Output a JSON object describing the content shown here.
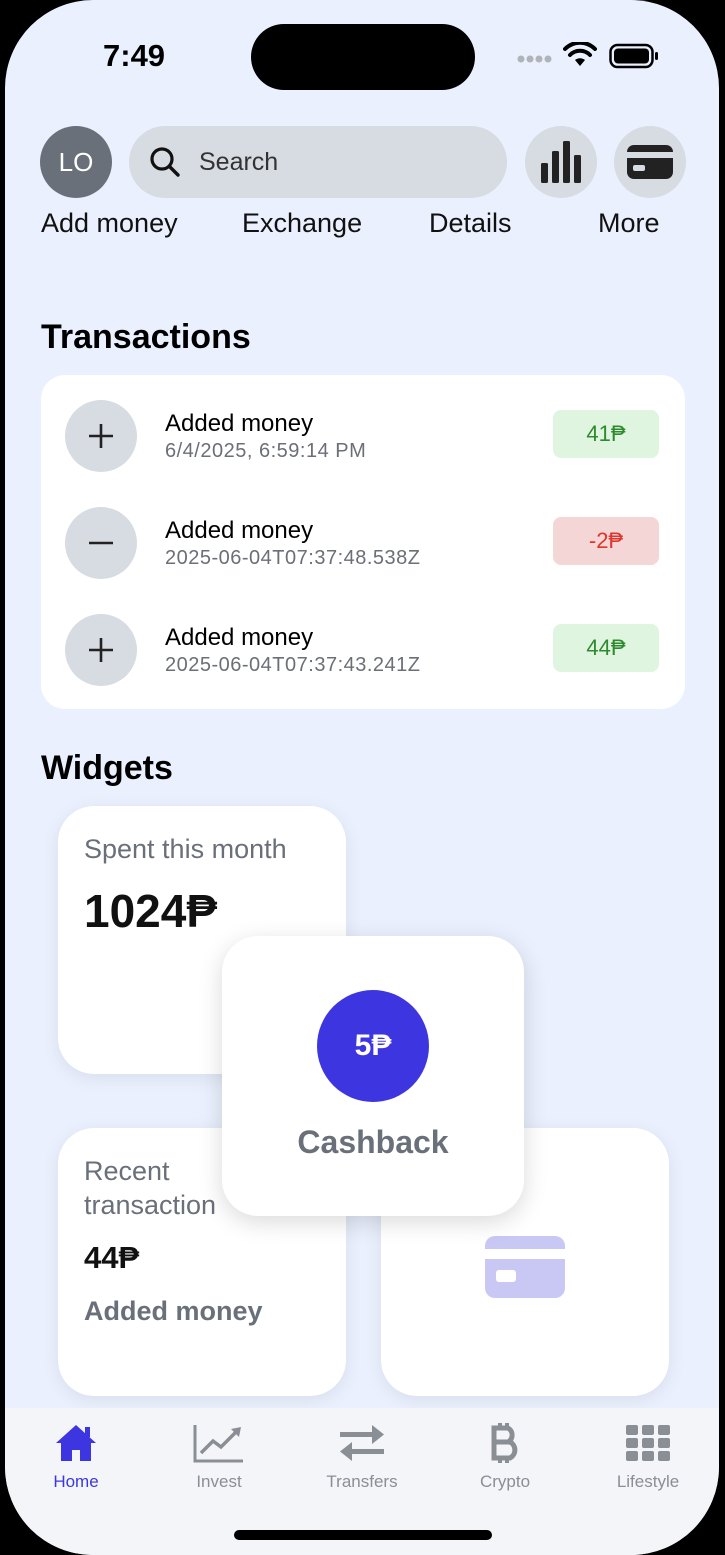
{
  "status": {
    "time": "7:49"
  },
  "header": {
    "avatar_initials": "LO",
    "search_placeholder": "Search",
    "stats_icon": "bar-chart-icon",
    "card_icon": "card-icon"
  },
  "actions": [
    {
      "label": "Add money"
    },
    {
      "label": "Exchange"
    },
    {
      "label": "Details"
    },
    {
      "label": "More"
    }
  ],
  "transactions": {
    "title": "Transactions",
    "items": [
      {
        "icon": "plus-icon",
        "title": "Added money",
        "date": "6/4/2025, 6:59:14 PM",
        "amount": "41₱",
        "type": "positive"
      },
      {
        "icon": "minus-icon",
        "title": "Added money",
        "date": "2025-06-04T07:37:48.538Z",
        "amount": "-2₱",
        "type": "negative"
      },
      {
        "icon": "plus-icon",
        "title": "Added money",
        "date": "2025-06-04T07:37:43.241Z",
        "amount": "44₱",
        "type": "positive"
      }
    ]
  },
  "widgets": {
    "title": "Widgets",
    "spent": {
      "label": "Spent this month",
      "value": "1024₱"
    },
    "cashback": {
      "value": "5₱",
      "label": "Cashback"
    },
    "recent": {
      "label_line1": "Recent",
      "label_line2": "transaction",
      "value": "44₱",
      "description": "Added money"
    },
    "card": {
      "icon": "card-icon"
    }
  },
  "tabbar": {
    "items": [
      {
        "label": "Home",
        "icon": "home-icon",
        "active": true
      },
      {
        "label": "Invest",
        "icon": "chart-line-icon",
        "active": false
      },
      {
        "label": "Transfers",
        "icon": "transfer-icon",
        "active": false
      },
      {
        "label": "Crypto",
        "icon": "bitcoin-icon",
        "active": false
      },
      {
        "label": "Lifestyle",
        "icon": "grid-icon",
        "active": false
      }
    ]
  },
  "colors": {
    "accent": "#3d36e0",
    "background": "#eaf0fd",
    "positive_bg": "#e0f5e0",
    "positive_text": "#2f8a2f",
    "negative_bg": "#f5d6d6",
    "negative_text": "#e0352d"
  }
}
